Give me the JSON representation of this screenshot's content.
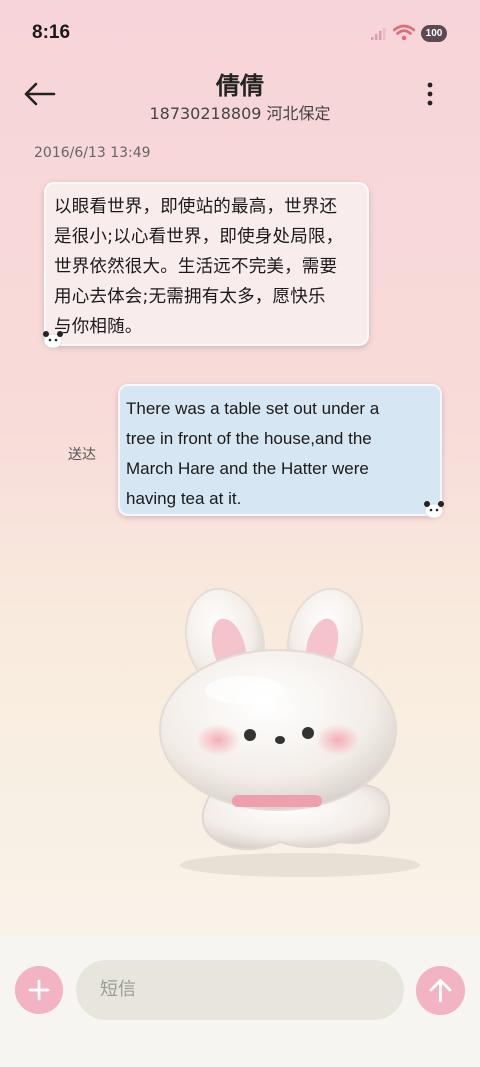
{
  "status_bar": {
    "time": "8:16",
    "battery": "100",
    "icons": [
      "signal-icon",
      "wifi-icon",
      "battery-icon"
    ]
  },
  "header": {
    "title": "倩倩",
    "subtitle": "18730218809 河北保定",
    "icons": [
      "arrow-left-icon",
      "more-vertical-icon"
    ]
  },
  "conversation": {
    "timestamp": "2016/6/13 13:49",
    "messages": [
      {
        "direction": "incoming",
        "lines": [
          "以眼看世界，即使站的最高，世界还",
          "是很小;以心看世界，即使身处局限，",
          "世界依然很大。生活远不完美，需要",
          "用心去体会;无需拥有太多，愿快乐",
          "与你相随。"
        ]
      },
      {
        "direction": "outgoing",
        "status": "送达",
        "lines": [
          "There was a table set out under a",
          "tree in front of the house,and the",
          "March Hare and the Hatter were",
          "having tea at it."
        ]
      }
    ]
  },
  "composer": {
    "placeholder": "短信",
    "icons": [
      "plus-icon",
      "arrow-up-icon"
    ]
  },
  "colors": {
    "accent_pink": "#f2b4c3",
    "incoming_bubble": "#f9ecec",
    "outgoing_bubble": "#d7e6f3"
  }
}
